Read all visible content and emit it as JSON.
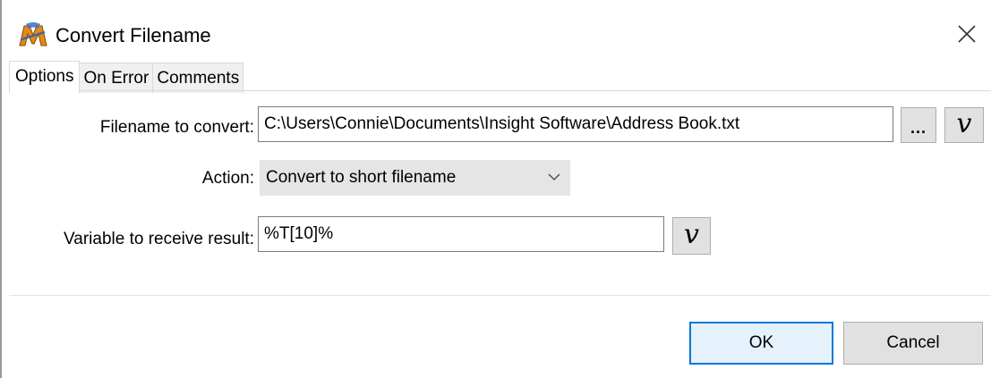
{
  "window": {
    "title": "Convert Filename",
    "app_icon": "macro-scheduler-m-icon",
    "close_icon": "close-icon"
  },
  "tabs": [
    {
      "label": "Options",
      "active": true
    },
    {
      "label": "On Error",
      "active": false
    },
    {
      "label": "Comments",
      "active": false
    }
  ],
  "form": {
    "filename": {
      "label": "Filename to convert:",
      "value": "C:\\Users\\Connie\\Documents\\Insight Software\\Address Book.txt",
      "browse_label": "...",
      "variable_label": "v"
    },
    "action": {
      "label": "Action:",
      "selected": "Convert to short filename"
    },
    "result": {
      "label": "Variable to receive result:",
      "value": "%T[10]%",
      "variable_label": "v"
    }
  },
  "buttons": {
    "ok": "OK",
    "cancel": "Cancel"
  },
  "colors": {
    "accent": "#0078d7",
    "button_face": "#e1e1e1"
  }
}
